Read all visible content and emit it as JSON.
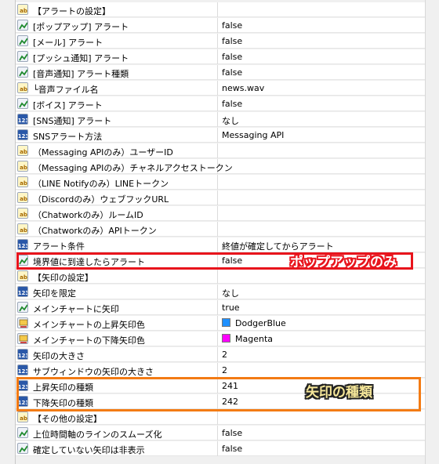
{
  "rows": [
    {
      "name": "【アラートの設定】",
      "value": "",
      "icon": "string-icon"
    },
    {
      "name": "[ポップアップ] アラート",
      "value": "false",
      "icon": "bool-icon"
    },
    {
      "name": "[メール] アラート",
      "value": "false",
      "icon": "bool-icon"
    },
    {
      "name": "[プッシュ通知] アラート",
      "value": "false",
      "icon": "bool-icon"
    },
    {
      "name": "[音声通知] アラート種類",
      "value": "false",
      "icon": "bool-icon"
    },
    {
      "name": "└音声ファイル名",
      "value": "news.wav",
      "icon": "string-icon"
    },
    {
      "name": "[ボイス] アラート",
      "value": "false",
      "icon": "bool-icon"
    },
    {
      "name": "[SNS通知] アラート",
      "value": "なし",
      "icon": "enum-icon"
    },
    {
      "name": "SNSアラート方法",
      "value": "Messaging API",
      "icon": "enum-icon"
    },
    {
      "name": "（Messaging APIのみ）ユーザーID",
      "value": "",
      "icon": "string-icon"
    },
    {
      "name": "（Messaging APIのみ）チャネルアクセストークン",
      "value": "",
      "icon": "string-icon"
    },
    {
      "name": "（LINE Notifyのみ）LINEトークン",
      "value": "",
      "icon": "string-icon"
    },
    {
      "name": "（Discordのみ）ウェブフックURL",
      "value": "",
      "icon": "string-icon"
    },
    {
      "name": "（Chatworkのみ）ルームID",
      "value": "",
      "icon": "string-icon"
    },
    {
      "name": "（Chatworkのみ）APIトークン",
      "value": "",
      "icon": "string-icon"
    },
    {
      "name": "アラート条件",
      "value": "終値が確定してからアラート",
      "icon": "enum-icon"
    },
    {
      "name": "境界値に到達したらアラート",
      "value": "false",
      "icon": "bool-icon"
    },
    {
      "name": "【矢印の設定】",
      "value": "",
      "icon": "string-icon"
    },
    {
      "name": "矢印を限定",
      "value": "なし",
      "icon": "enum-icon"
    },
    {
      "name": "メインチャートに矢印",
      "value": "true",
      "icon": "bool-icon"
    },
    {
      "name": "メインチャートの上昇矢印色",
      "value": "DodgerBlue",
      "icon": "color-icon",
      "swatch": "#1E90FF"
    },
    {
      "name": "メインチャートの下降矢印色",
      "value": "Magenta",
      "icon": "color-icon",
      "swatch": "#FF00FF"
    },
    {
      "name": "矢印の大きさ",
      "value": "2",
      "icon": "enum-icon"
    },
    {
      "name": "サブウィンドウの矢印の大きさ",
      "value": "2",
      "icon": "enum-icon"
    },
    {
      "name": "上昇矢印の種類",
      "value": "241",
      "icon": "enum-icon"
    },
    {
      "name": "下降矢印の種類",
      "value": "242",
      "icon": "enum-icon"
    },
    {
      "name": "【その他の設定】",
      "value": "",
      "icon": "string-icon"
    },
    {
      "name": "上位時間軸のラインのスムーズ化",
      "value": "false",
      "icon": "bool-icon"
    },
    {
      "name": "確定していない矢印は非表示",
      "value": "false",
      "icon": "bool-icon"
    }
  ],
  "callouts": {
    "popup_only": "ポップアップのみ",
    "arrow_type": "矢印の種類"
  },
  "colors": {
    "red_highlight": "#e8141c",
    "orange_highlight": "#f37b14"
  }
}
